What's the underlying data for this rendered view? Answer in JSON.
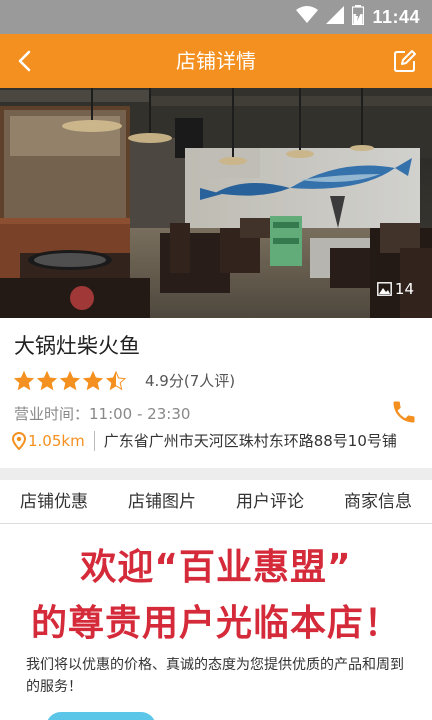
{
  "status_bar": {
    "time": "11:44"
  },
  "nav": {
    "title": "店铺详情"
  },
  "hero": {
    "photo_count": "14"
  },
  "shop": {
    "name": "大锅灶柴火鱼",
    "rating": 4.5,
    "rating_text": "4.9分(7人评)",
    "hours": "营业时间：11:00 - 23:30",
    "distance": "1.05km",
    "address": "广东省广州市天河区珠村东环路88号10号铺"
  },
  "tabs": [
    {
      "label": "店铺优惠"
    },
    {
      "label": "店铺图片"
    },
    {
      "label": "用户评论"
    },
    {
      "label": "商家信息"
    }
  ],
  "promo": {
    "line1": "欢迎“百业惠盟”",
    "line2": "的尊贵用户光临本店！",
    "description": "我们将以优惠的价格、真诚的态度为您提供优质的产品和周到的服务！"
  },
  "colors": {
    "accent": "#f4901f",
    "promo_red": "#d42a3a",
    "status_bar": "#9a9a9a"
  }
}
